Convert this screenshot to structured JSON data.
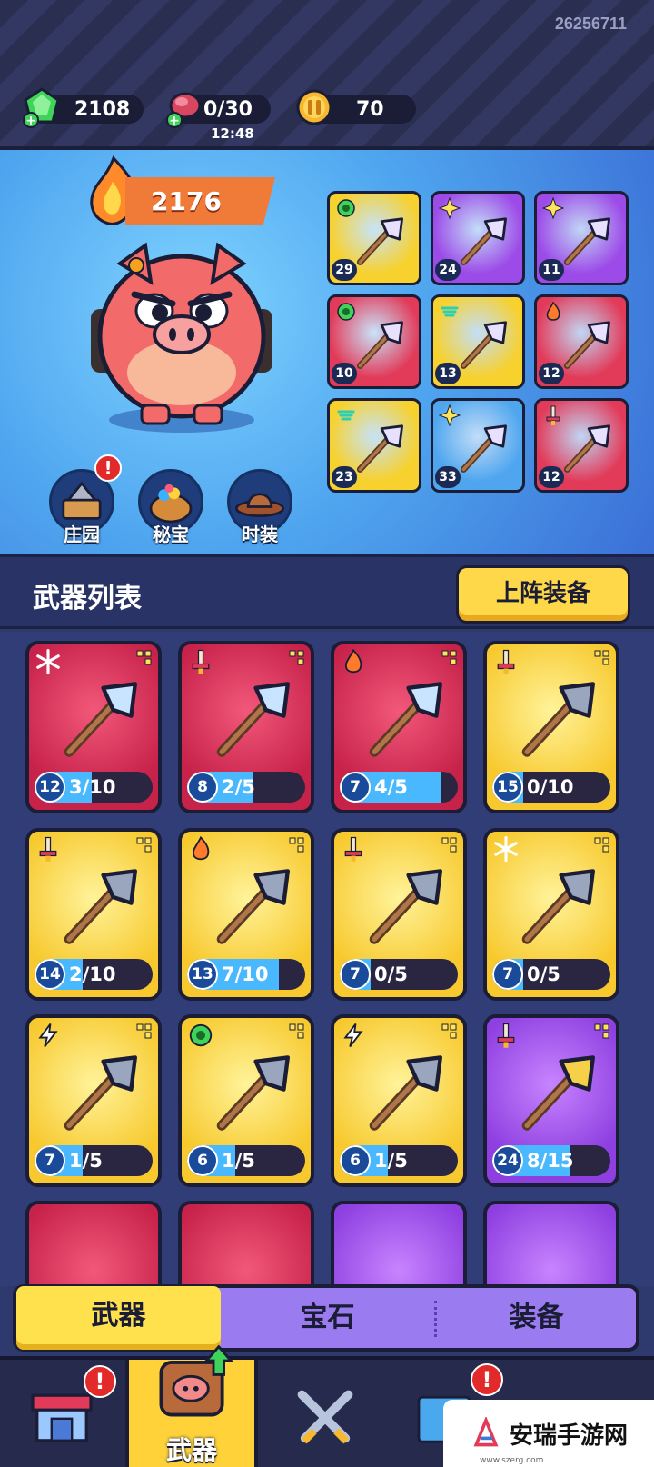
{
  "topbar": {
    "user_id": "26256711",
    "gems": "2108",
    "stamina": "0/30",
    "stamina_timer": "12:48",
    "coins": "70"
  },
  "hero": {
    "power": "2176",
    "buttons": [
      {
        "label": "庄园",
        "icon": "manor-icon",
        "alert": "!"
      },
      {
        "label": "秘宝",
        "icon": "treasure-pot-icon"
      },
      {
        "label": "时装",
        "icon": "cowboy-hat-icon"
      }
    ],
    "gear": [
      {
        "level": "29",
        "color": "#f7d12e",
        "element": "poison",
        "item": "lizard-staff"
      },
      {
        "level": "24",
        "color": "#9c4ae8",
        "element": "light",
        "item": "golden-shield"
      },
      {
        "level": "11",
        "color": "#9c4ae8",
        "element": "light",
        "item": "wizard-hat"
      },
      {
        "level": "10",
        "color": "#e23b5a",
        "element": "poison",
        "item": "armor-chest"
      },
      {
        "level": "13",
        "color": "#f7d12e",
        "element": "wind",
        "item": "bell"
      },
      {
        "level": "12",
        "color": "#e23b5a",
        "element": "fire",
        "item": "feather-fan"
      },
      {
        "level": "23",
        "color": "#f7d12e",
        "element": "wind",
        "item": "feather-wand"
      },
      {
        "level": "33",
        "color": "#4fa6ef",
        "element": "light",
        "item": "glove"
      },
      {
        "level": "12",
        "color": "#e23b5a",
        "element": "sword",
        "item": "dagger"
      }
    ]
  },
  "section": {
    "title": "武器列表",
    "equip_button": "上阵装备"
  },
  "weapons": [
    {
      "level": "12",
      "progress": "3/10",
      "fraction": 0.3,
      "rarity": "red",
      "element": "ice",
      "item": "ice-pick"
    },
    {
      "level": "8",
      "progress": "2/5",
      "fraction": 0.4,
      "rarity": "red",
      "element": "sword",
      "item": "arrow"
    },
    {
      "level": "7",
      "progress": "4/5",
      "fraction": 0.8,
      "rarity": "red",
      "element": "fire",
      "item": "tomahawk"
    },
    {
      "level": "15",
      "progress": "0/10",
      "fraction": 0.0,
      "rarity": "yellow",
      "element": "sword",
      "item": "blaster"
    },
    {
      "level": "14",
      "progress": "2/10",
      "fraction": 0.2,
      "rarity": "yellow",
      "element": "sword",
      "item": "axe"
    },
    {
      "level": "13",
      "progress": "7/10",
      "fraction": 0.7,
      "rarity": "yellow",
      "element": "fire",
      "item": "hook"
    },
    {
      "level": "7",
      "progress": "0/5",
      "fraction": 0.0,
      "rarity": "yellow",
      "element": "sword",
      "item": "hammer"
    },
    {
      "level": "7",
      "progress": "0/5",
      "fraction": 0.0,
      "rarity": "yellow",
      "element": "ice",
      "item": "crystal"
    },
    {
      "level": "7",
      "progress": "1/5",
      "fraction": 0.2,
      "rarity": "yellow",
      "element": "lightning",
      "item": "staff"
    },
    {
      "level": "6",
      "progress": "1/5",
      "fraction": 0.2,
      "rarity": "yellow",
      "element": "poison",
      "item": "spear"
    },
    {
      "level": "6",
      "progress": "1/5",
      "fraction": 0.2,
      "rarity": "yellow",
      "element": "lightning",
      "item": "bag"
    },
    {
      "level": "24",
      "progress": "8/15",
      "fraction": 0.533,
      "rarity": "purple",
      "element": "sword",
      "item": "bone-scythe"
    }
  ],
  "tabs": [
    "武器",
    "宝石",
    "装备"
  ],
  "nav": {
    "weapon_label": "武器",
    "shop_alert": "!",
    "event_alert": "!"
  },
  "watermark": {
    "title": "安瑞手游网",
    "site": "www.szerg.com"
  }
}
